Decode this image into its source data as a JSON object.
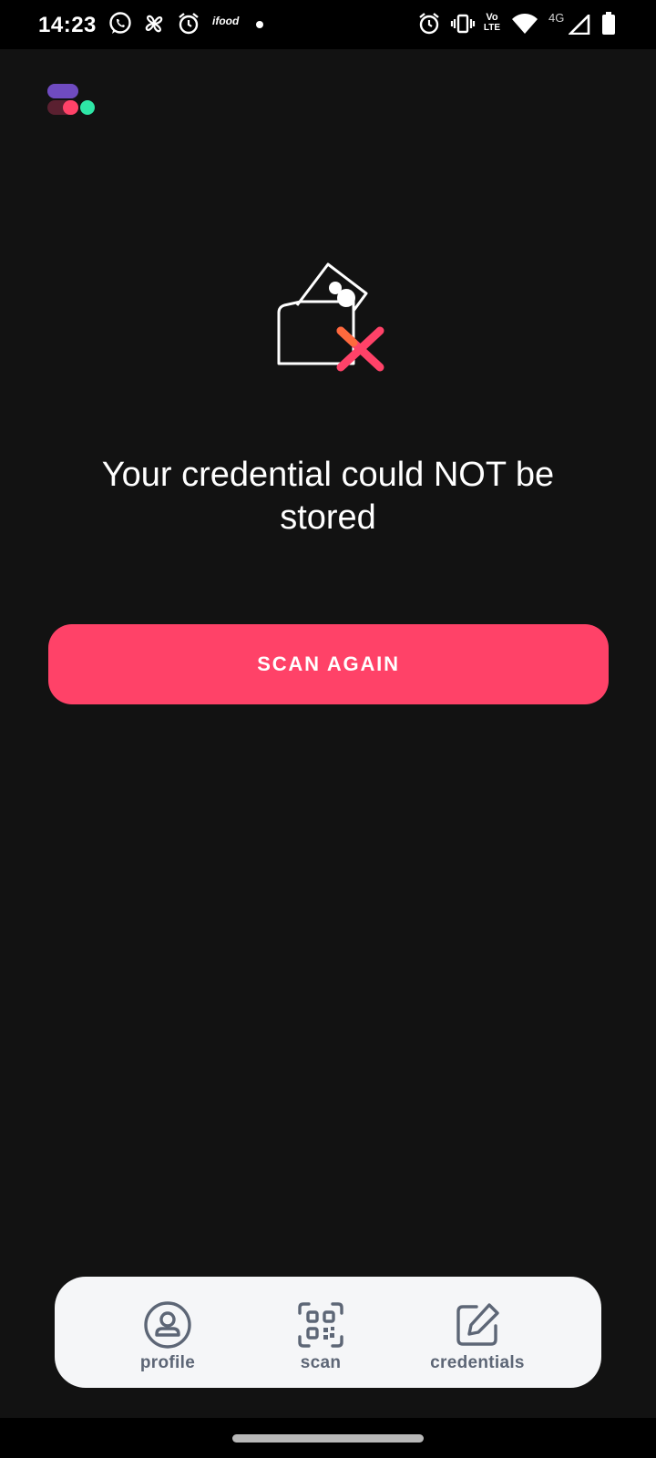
{
  "status_bar": {
    "time": "14:23",
    "left_icons": [
      "whatsapp-icon",
      "fan-icon",
      "alarm-icon",
      "ifood-icon",
      "dot-icon"
    ],
    "ifood_label": "ifood",
    "right_icons": [
      "alarm-icon",
      "vibrate-icon",
      "volte-icon",
      "wifi-icon",
      "signal-icon",
      "battery-icon"
    ],
    "volte_top": "Vo",
    "volte_bottom": "LTE",
    "network_type": "4G"
  },
  "app": {
    "logo": "app-logo",
    "hero_icon": "wallet-error-icon",
    "message": "Your credential could NOT be stored",
    "primary_button_label": "SCAN AGAIN"
  },
  "bottom_nav": {
    "items": [
      {
        "label": "profile",
        "icon": "profile-icon"
      },
      {
        "label": "scan",
        "icon": "qr-code-icon"
      },
      {
        "label": "credentials",
        "icon": "edit-icon"
      }
    ]
  },
  "colors": {
    "background": "#121212",
    "accent": "#FF4268",
    "nav_background": "#F5F6F8",
    "nav_text": "#5D6676"
  }
}
